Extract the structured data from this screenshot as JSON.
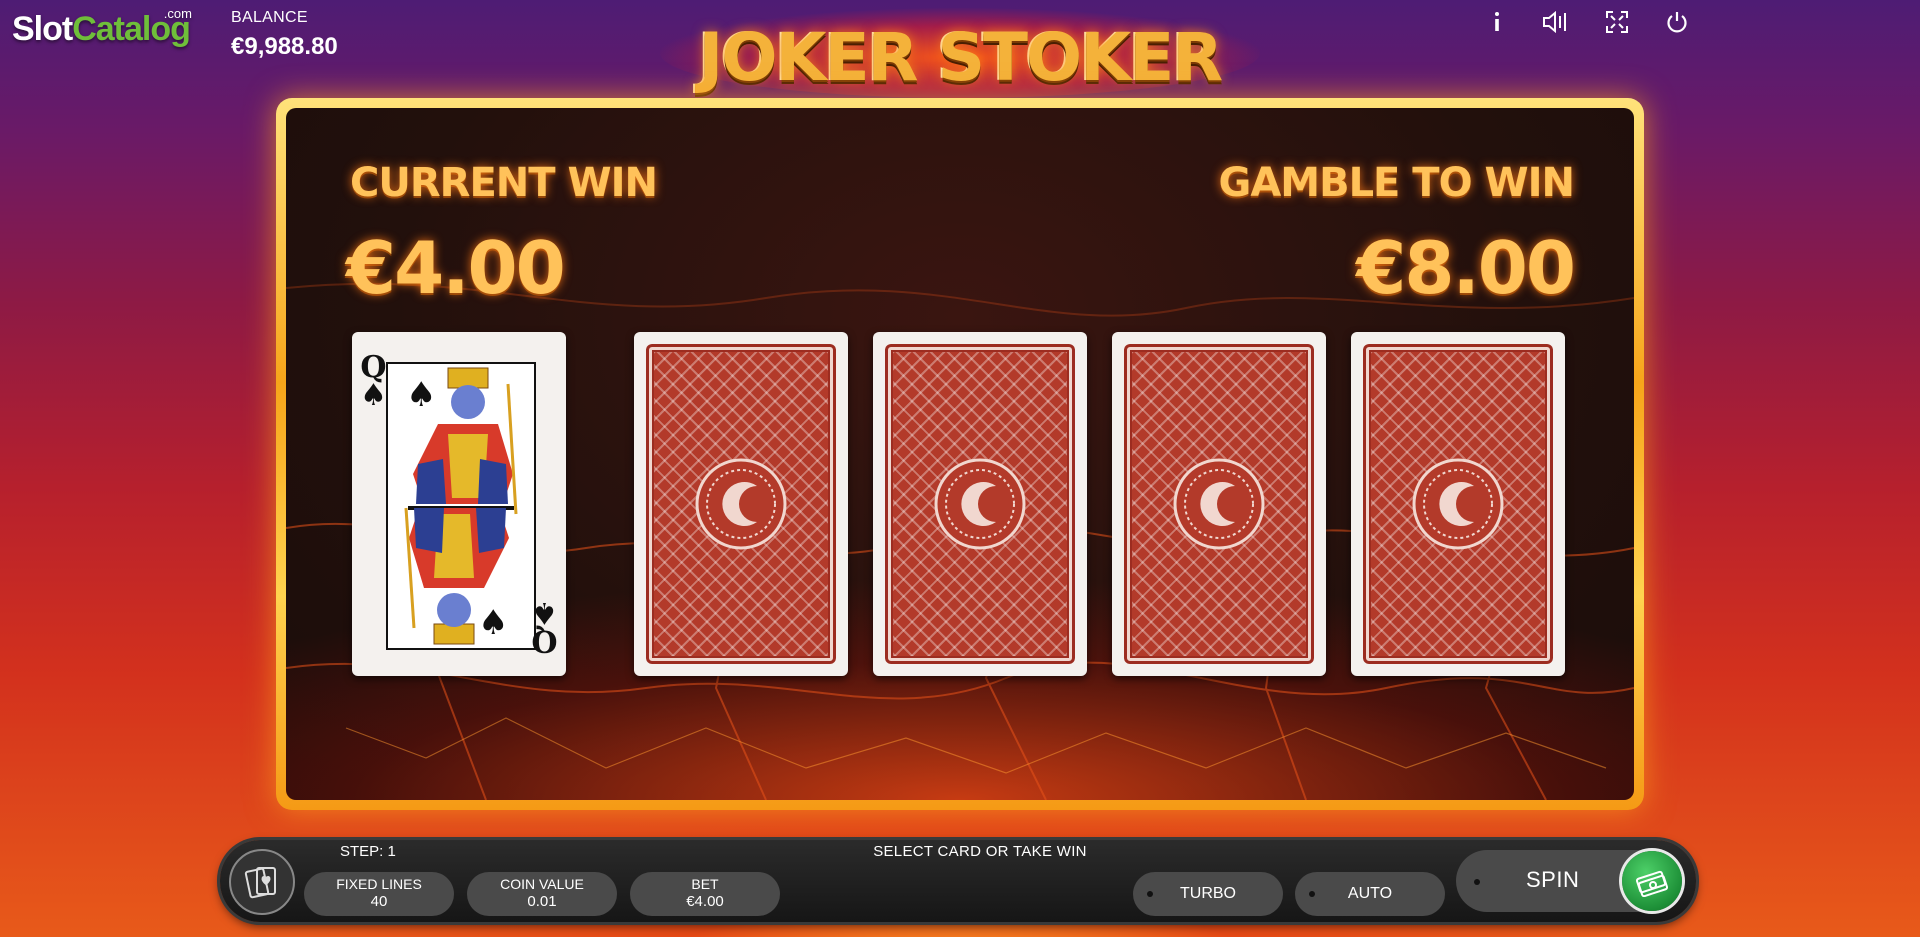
{
  "brand": {
    "part1": "Slot",
    "part2": "Catalog",
    "suffix": ".com"
  },
  "balance": {
    "label": "BALANCE",
    "value": "€9,988.80"
  },
  "game_title": "JOKER STOKER",
  "header_icons": [
    "info-icon",
    "sound-icon",
    "fullscreen-icon",
    "power-icon"
  ],
  "gamble": {
    "current_win_label": "CURRENT WIN",
    "current_win_value": "€4.00",
    "gamble_label": "GAMBLE TO WIN",
    "gamble_value": "€8.00",
    "dealer_card": {
      "rank": "Q",
      "suit": "♠"
    },
    "face_down_cards": 4
  },
  "bottom_bar": {
    "step": "STEP: 1",
    "message": "SELECT CARD OR TAKE WIN",
    "fixed_lines_label": "FIXED LINES",
    "fixed_lines_value": "40",
    "coin_value_label": "COIN VALUE",
    "coin_value_value": "0.01",
    "bet_label": "BET",
    "bet_value": "€4.00",
    "turbo_label": "TURBO",
    "auto_label": "AUTO",
    "spin_label": "SPIN"
  },
  "colors": {
    "accent_gold": "#ffc25a",
    "frame_gold": "#f7a51a",
    "card_back": "#b33a2a",
    "spin_green": "#1d8f37"
  }
}
